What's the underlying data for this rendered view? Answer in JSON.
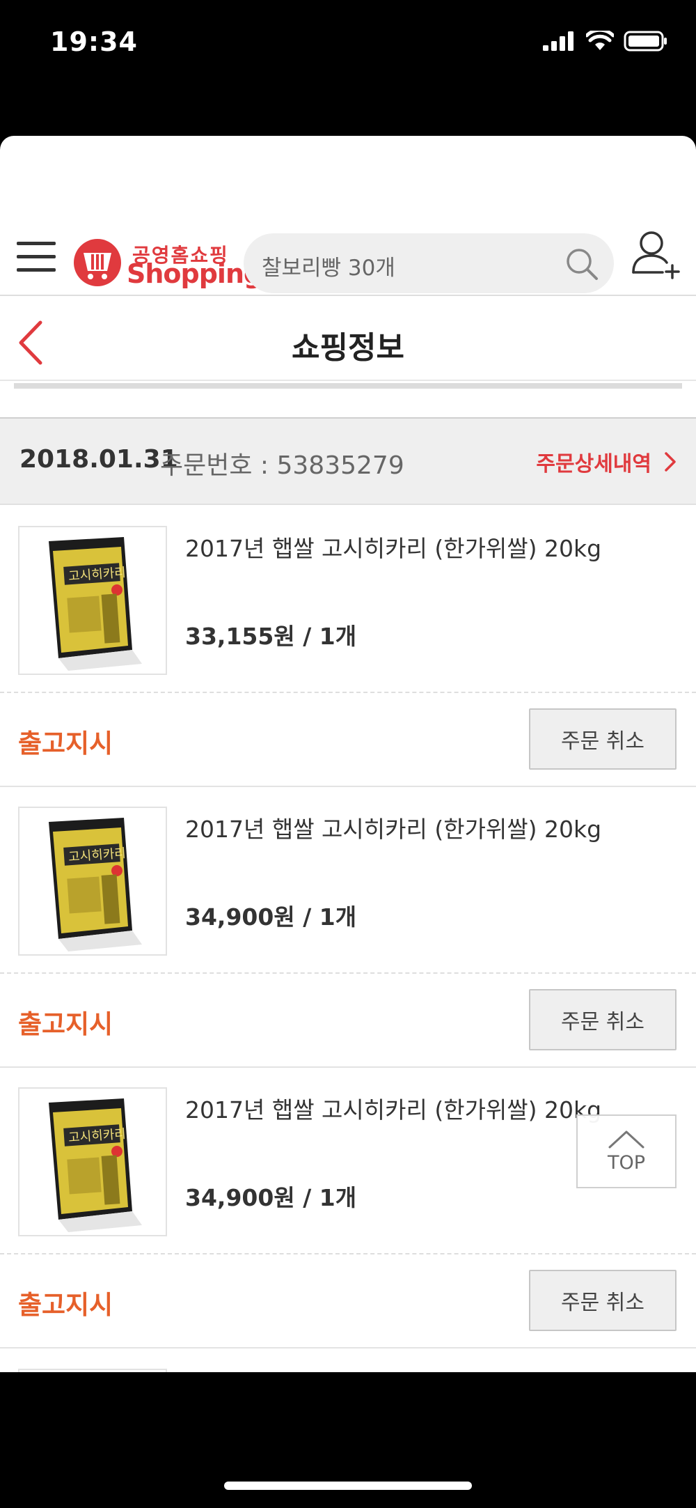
{
  "status_bar": {
    "time": "19:34"
  },
  "header": {
    "logo_top": "공영홈쇼핑",
    "logo_main": "Shopping",
    "search_value": "찰보리빵 30개"
  },
  "title_bar": {
    "title": "쇼핑정보"
  },
  "order": {
    "date": "2018.01.31",
    "number_text": "주문번호 : 53835279",
    "detail_link": "주문상세내역"
  },
  "items": [
    {
      "name": "2017년 햅쌀 고시히카리 (한가위쌀) 20kg",
      "price": "33,155원 / 1개",
      "status": "출고지시",
      "cancel_label": "주문 취소"
    },
    {
      "name": "2017년 햅쌀 고시히카리 (한가위쌀) 20kg",
      "price": "34,900원 / 1개",
      "status": "출고지시",
      "cancel_label": "주문 취소"
    },
    {
      "name": "2017년 햅쌀 고시히카리 (한가위쌀) 20kg",
      "price": "34,900원 / 1개",
      "status": "출고지시",
      "cancel_label": "주문 취소"
    }
  ],
  "top_button": {
    "label": "TOP"
  },
  "colors": {
    "brand": "#e03a3e",
    "status": "#e6602a"
  },
  "icons": {
    "menu": "hamburger-icon",
    "search": "search-icon",
    "user_add": "user-add-icon",
    "back": "chevron-left-icon",
    "detail": "chevron-right-icon",
    "top": "chevron-up-icon"
  }
}
